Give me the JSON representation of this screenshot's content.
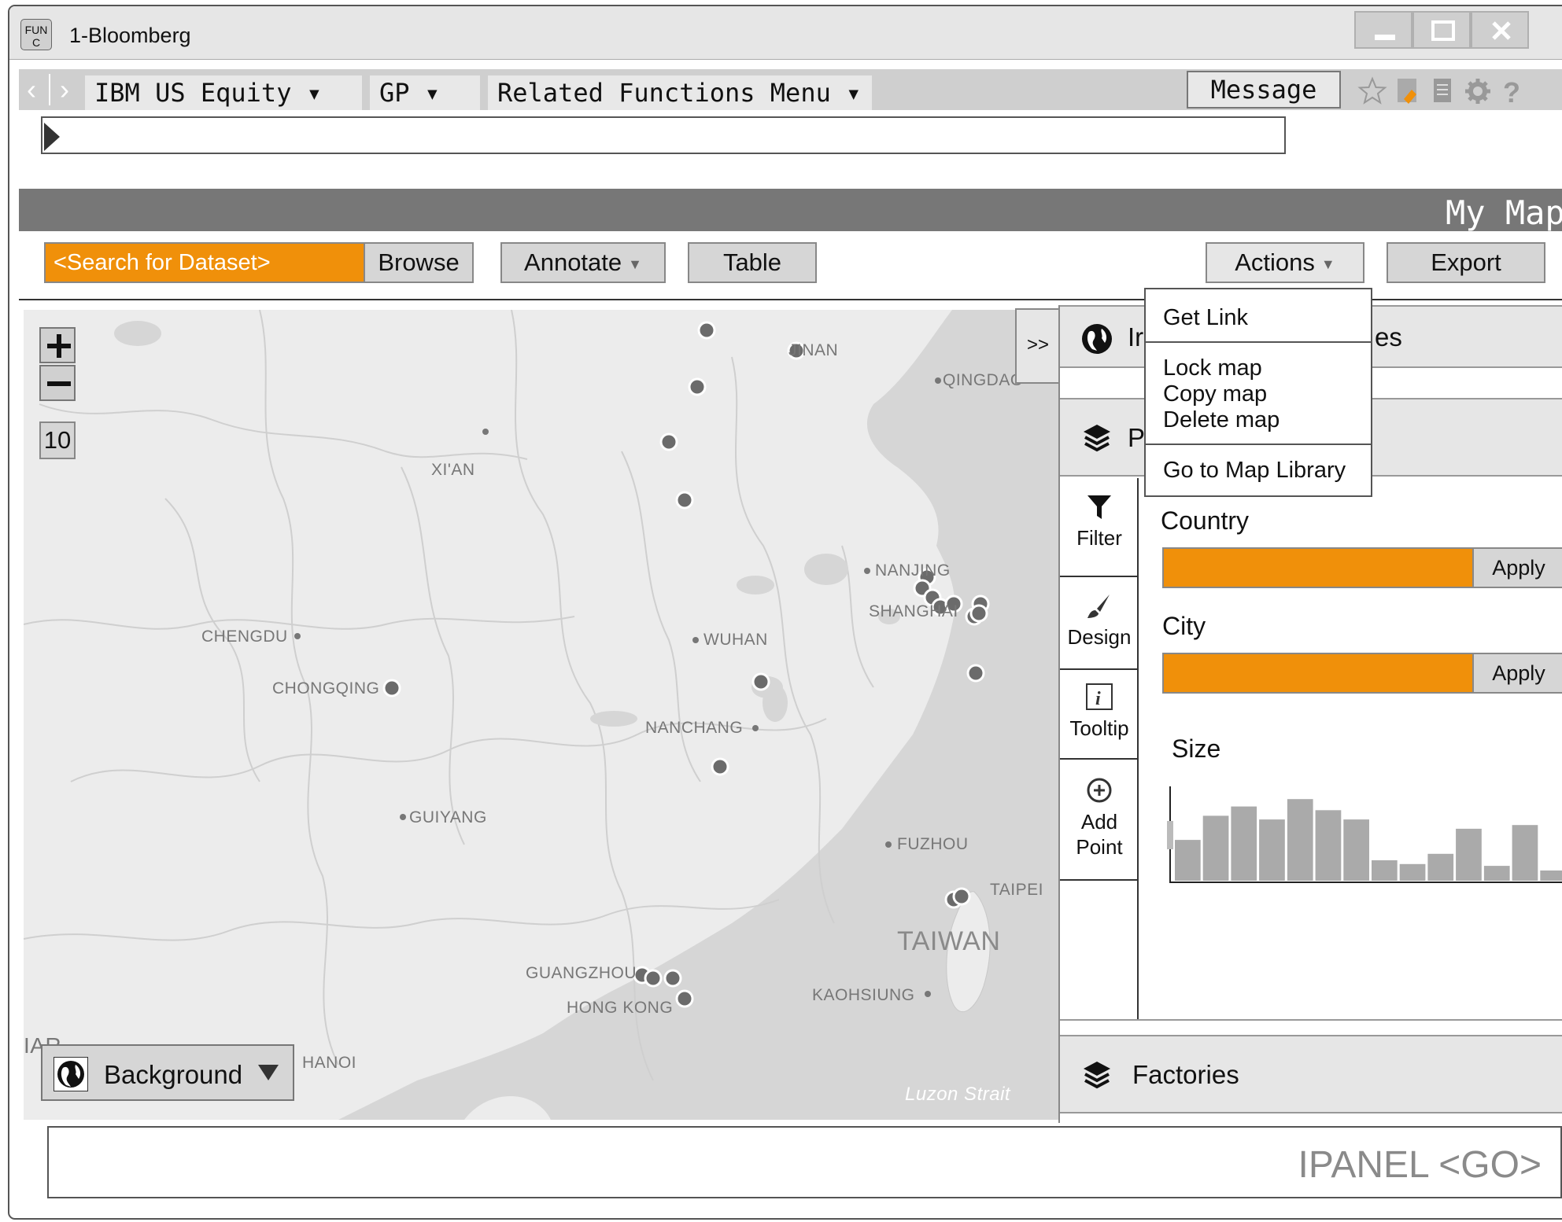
{
  "window": {
    "badge": "FUN C",
    "title": "1-Bloomberg"
  },
  "command_bar": {
    "security": "IBM US Equity",
    "function": "GP",
    "related": "Related Functions Menu",
    "message": "Message"
  },
  "header": {
    "title": "My Maps"
  },
  "toolbar": {
    "search_placeholder": "<Search for Dataset>",
    "browse": "Browse",
    "annotate": "Annotate",
    "table": "Table",
    "actions": "Actions",
    "export": "Export"
  },
  "actions_menu": {
    "get_link": "Get Link",
    "lock_map": "Lock map",
    "copy_map": "Copy map",
    "delete_map": "Delete map",
    "go_library": "Go to Map Library"
  },
  "map": {
    "zoom_level": "10",
    "background_label": "Background",
    "strait_label": "Luzon Strait",
    "taiwan_label": "TAIWAN",
    "partial_label": "IAR",
    "cities": [
      {
        "name": "JINAN"
      },
      {
        "name": "QINGDAO"
      },
      {
        "name": "XI'AN"
      },
      {
        "name": "NANJING"
      },
      {
        "name": "SHANGHAI"
      },
      {
        "name": "CHENGDU"
      },
      {
        "name": "WUHAN"
      },
      {
        "name": "CHONGQING"
      },
      {
        "name": "NANCHANG"
      },
      {
        "name": "GUIYANG"
      },
      {
        "name": "FUZHOU"
      },
      {
        "name": "TAIPEI"
      },
      {
        "name": "GUANGZHOU"
      },
      {
        "name": "KAOHSIUNG"
      },
      {
        "name": "HONG KONG"
      },
      {
        "name": "HANOI"
      }
    ]
  },
  "panel": {
    "layer1_label": "Ir",
    "layer1_suffix": "es",
    "layer2_label": "P",
    "layer3_label": "Factories",
    "tabs": [
      {
        "label": "Filter"
      },
      {
        "label": "Design"
      },
      {
        "label": "Tooltip"
      },
      {
        "label": "Add Point"
      }
    ],
    "filters": [
      {
        "label": "Country",
        "apply": "Apply"
      },
      {
        "label": "City",
        "apply": "Apply"
      }
    ],
    "size_label": "Size",
    "size_histogram": [
      0.44,
      0.7,
      0.8,
      0.66,
      0.88,
      0.76,
      0.66,
      0.22,
      0.18,
      0.29,
      0.56,
      0.16,
      0.6,
      0.11
    ]
  },
  "bottom": {
    "ipanel": "IPANEL <GO>"
  },
  "colors": {
    "accent_orange": "#f0900a",
    "header_gray": "#777777",
    "map_bg": "#ececec"
  }
}
